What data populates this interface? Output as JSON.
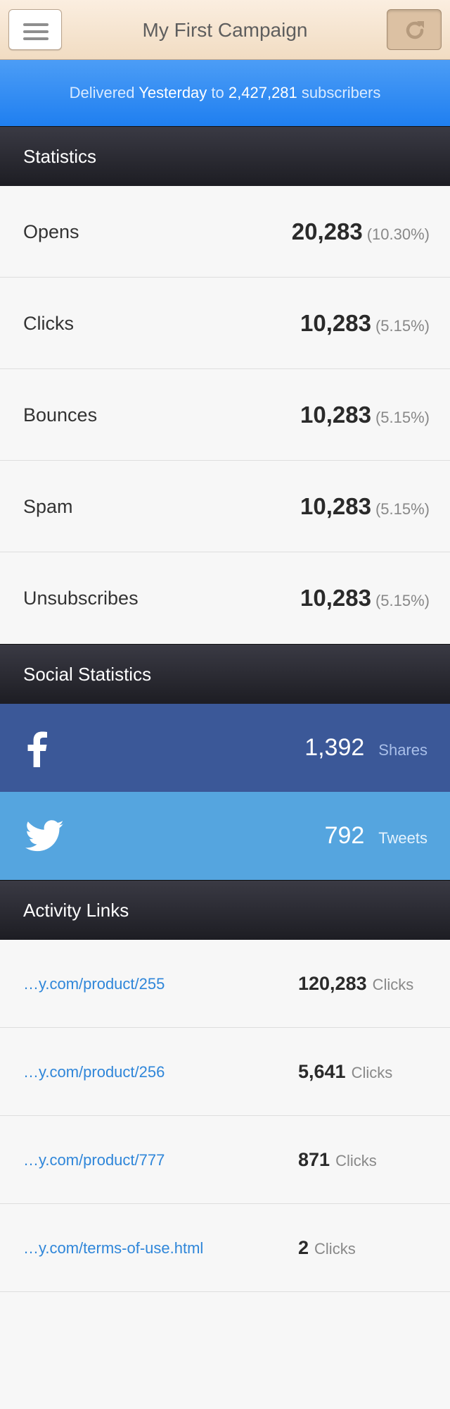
{
  "header": {
    "title": "My First Campaign",
    "menu_icon": "hamburger-icon",
    "refresh_icon": "refresh-icon"
  },
  "delivery": {
    "prefix": "Delivered",
    "when": "Yesterday",
    "to": "to",
    "count": "2,427,281",
    "suffix": "subscribers"
  },
  "statistics": {
    "heading": "Statistics",
    "rows": [
      {
        "label": "Opens",
        "value": "20,283",
        "percent": "(10.30%)"
      },
      {
        "label": "Clicks",
        "value": "10,283",
        "percent": "(5.15%)"
      },
      {
        "label": "Bounces",
        "value": "10,283",
        "percent": "(5.15%)"
      },
      {
        "label": "Spam",
        "value": "10,283",
        "percent": "(5.15%)"
      },
      {
        "label": "Unsubscribes",
        "value": "10,283",
        "percent": "(5.15%)"
      }
    ]
  },
  "social": {
    "heading": "Social Statistics",
    "facebook": {
      "icon": "facebook-icon",
      "count": "1,392",
      "unit": "Shares",
      "color": "#3b5898"
    },
    "twitter": {
      "icon": "twitter-icon",
      "count": "792",
      "unit": "Tweets",
      "color": "#55a5df"
    }
  },
  "activity": {
    "heading": "Activity Links",
    "links": [
      {
        "url": "…y.com/product/255",
        "clicks": "120,283",
        "unit": "Clicks"
      },
      {
        "url": "…y.com/product/256",
        "clicks": "5,641",
        "unit": "Clicks"
      },
      {
        "url": "…y.com/product/777",
        "clicks": "871",
        "unit": "Clicks"
      },
      {
        "url": "…y.com/terms-of-use.html",
        "clicks": "2",
        "unit": "Clicks"
      }
    ]
  },
  "colors": {
    "accent_blue": "#1f7ff0",
    "header_dark": "#1d1d23",
    "link_blue": "#2f86d9"
  }
}
